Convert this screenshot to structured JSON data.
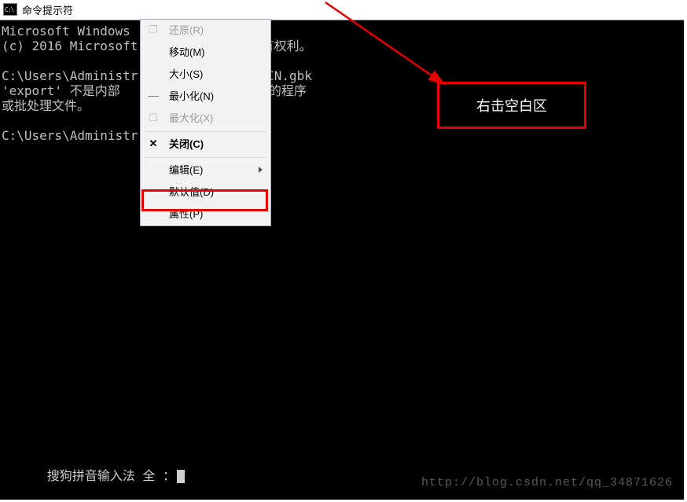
{
  "titlebar": {
    "title": "命令提示符"
  },
  "console": {
    "l1": "Microsoft Windows             ]",
    "l2": "(c) 2016 Microsoft             留所有权利。",
    "l3": "C:\\Users\\Administr            G=zh_CN.gbk",
    "l4": "'export' 不是内部             是可运行的程序",
    "l5": "或批处理文件。",
    "l6": "C:\\Users\\Administr"
  },
  "menu": {
    "restore": "还原(R)",
    "move": "移动(M)",
    "size": "大小(S)",
    "minimize": "最小化(N)",
    "maximize": "最大化(X)",
    "close": "关闭(C)",
    "edit": "编辑(E)",
    "defaults": "默认值(D)",
    "properties": "属性(P)"
  },
  "annotation": {
    "text": "右击空白区"
  },
  "ime": {
    "text": "搜狗拼音输入法 全 ："
  },
  "watermark": {
    "text": "http://blog.csdn.net/qq_34871626"
  }
}
